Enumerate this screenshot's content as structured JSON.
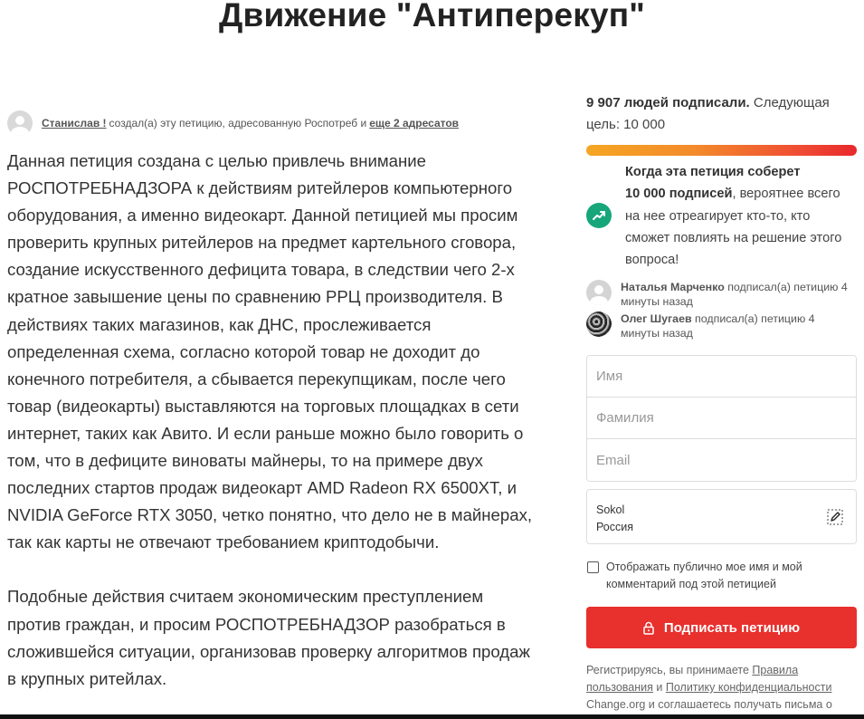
{
  "page": {
    "title": "Движение \"Антиперекуп\""
  },
  "author": {
    "name": "Станислав !",
    "action": "создал(а) эту петицию, адресованную Роспотреб и",
    "more_link": "еще 2 адресатов"
  },
  "body": {
    "paragraphs": [
      "Данная петиция создана с целью привлечь внимание РОСПОТРЕБНАДЗОРА к действиям ритейлеров компьютерного оборудования, а именно видеокарт. Данной петицией мы просим проверить крупных ритейлеров на предмет картельного сговора, создание искусственного дефицита товара, в следствии чего 2-х кратное завышение цены по сравнению РРЦ производителя. В действиях таких магазинов, как ДНС, прослеживается определенная схема, согласно которой товар не доходит до конечного потребителя, а сбывается перекупщикам, после чего товар (видеокарты) выставляются на торговых площадках в сети интернет, таких как Авито. И если раньше можно было говорить о том, что в дефиците виноваты майнеры, то на примере двух последних стартов продаж видеокарт AMD Radeon RX 6500XT, и NVIDIA GeForce RTX 3050, четко понятно, что дело не в майнерах, так как карты не отвечают требованием криптодобычи.",
      "Подобные действия считаем экономическим преступлением против граждан, и просим РОСПОТРЕБНАДЗОР разобраться в сложившейся ситуации, организовав проверку алгоритмов продаж в крупных ритейлах."
    ]
  },
  "sidebar": {
    "signed_count_text": "9 907 людей подписали.",
    "next_goal_text": "Следующая цель: 10 000",
    "progress_fraction": 0.9907,
    "progress_colors": [
      "#f5a623",
      "#e8282c"
    ],
    "notice": {
      "bold_prefix": "Когда эта петиция соберет",
      "bold_count": "10 000 подписей",
      "rest": ", вероятнее всего на нее отреагирует кто-то, кто сможет повлиять на решение этого вопроса!",
      "icon": "trending-up-icon",
      "icon_color": "#17a67a"
    },
    "recent_signers": [
      {
        "name": "Наталья Марченко",
        "text": "подписал(а) петицию 4 минуты назад"
      },
      {
        "name": "Олег Шугаев",
        "text": "подписал(а) петицию 4 минуты назад"
      }
    ],
    "form": {
      "first_name_placeholder": "Имя",
      "last_name_placeholder": "Фамилия",
      "email_placeholder": "Email",
      "city": "Sokol",
      "country": "Россия",
      "public_checkbox_label": "Отображать публично мое имя и мой комментарий под этой петицией",
      "sign_button_label": "Подписать петицию",
      "accent_color": "#e8302d"
    },
    "legal": {
      "prefix": "Регистрируясь, вы принимаете",
      "terms_link": "Правила пользования",
      "and": "и",
      "privacy_link": "Политику конфиденциальности",
      "suffix": "Change.org и соглашаетесь получать письма о"
    }
  }
}
